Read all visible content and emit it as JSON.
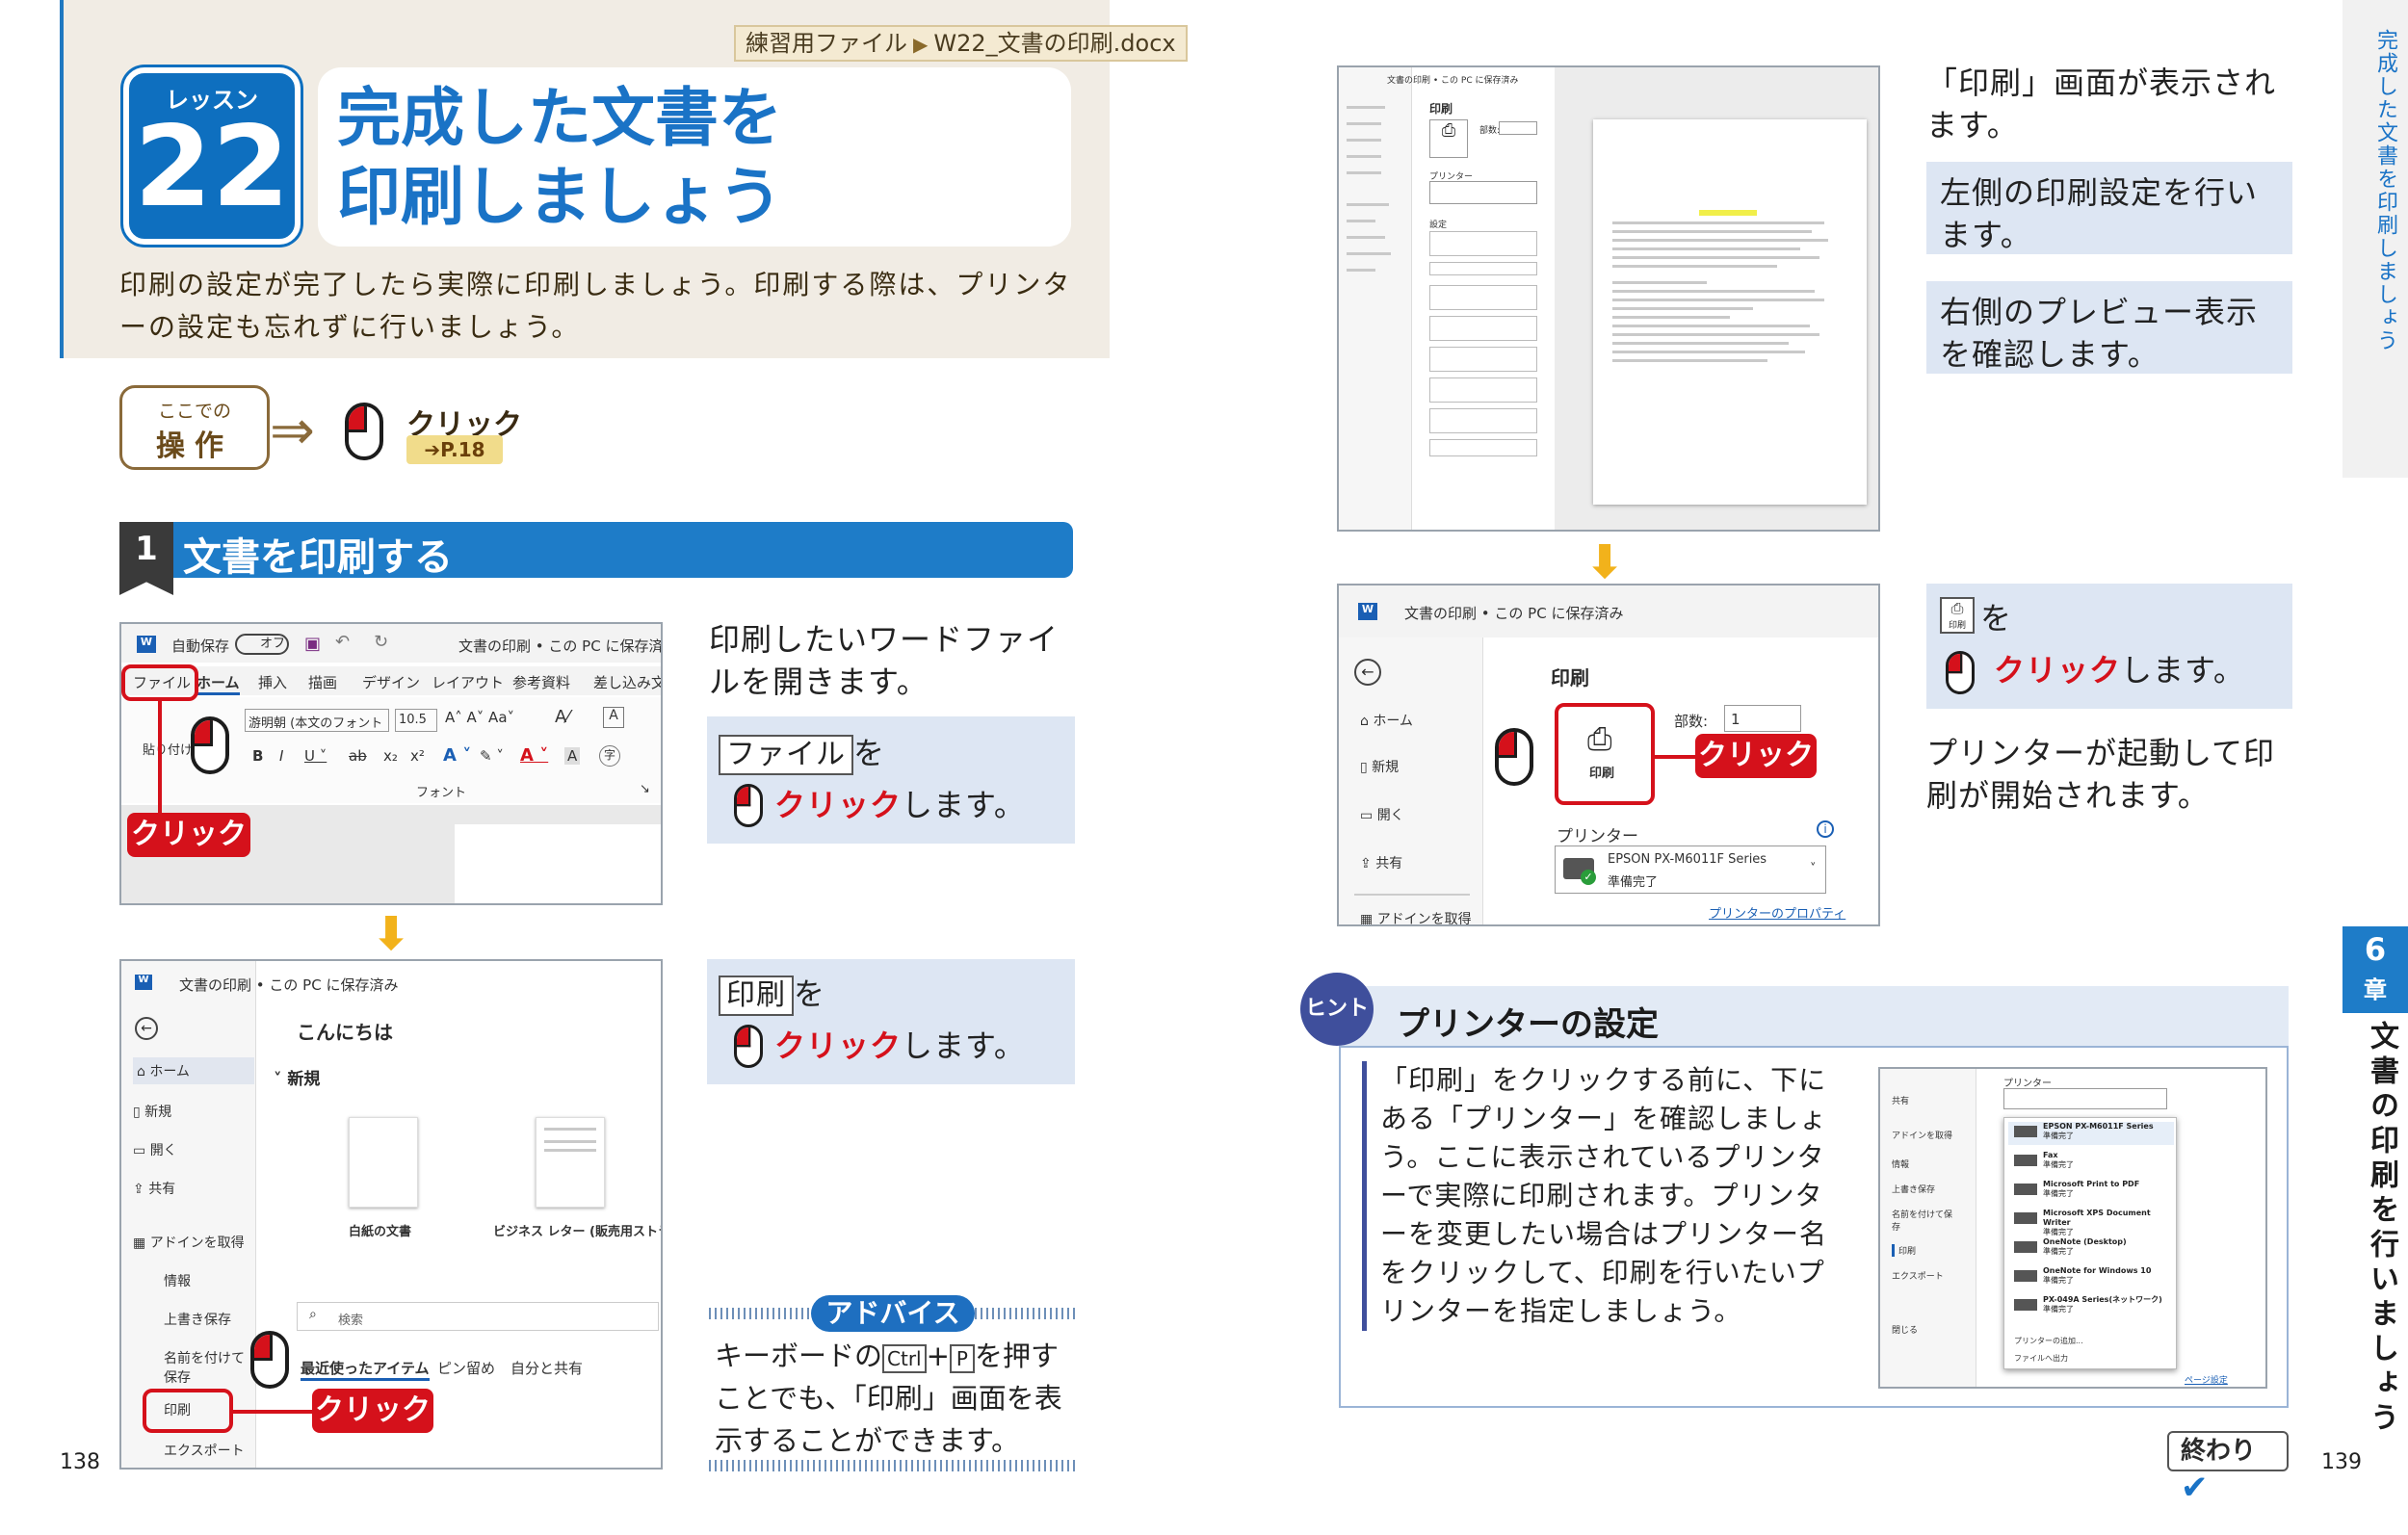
{
  "left_page": {
    "practice_file": {
      "label": "練習用ファイル",
      "file": "W22_文書の印刷.docx"
    },
    "lesson": {
      "label": "レッスン",
      "number": "22"
    },
    "title_line1": "完成した文書を",
    "title_line2": "印刷しましょう",
    "intro": "印刷の設定が完了したら実際に印刷しましょう。印刷する際は、プリンターの設定も忘れずに行いましょう。",
    "operation": {
      "small": "ここでの",
      "big": "操作",
      "action": "クリック",
      "ref": "P.18"
    },
    "section": {
      "number": "1",
      "title": "文書を印刷する"
    },
    "step1": {
      "text": "印刷したいワードファイルを開きます。",
      "key": "ファイル",
      "key_suffix": "を",
      "click": "クリック",
      "suffix": "します。"
    },
    "step2": {
      "key": "印刷",
      "key_suffix": "を",
      "click": "クリック",
      "suffix": "します。"
    },
    "advice": {
      "label": "アドバイス",
      "text_pre": "キーボードの",
      "ctrl": "Ctrl",
      "plus": "+",
      "p": "P",
      "text_post": "を押すことでも、「印刷」画面を表示することができます。"
    },
    "page_number": "138",
    "shot1": {
      "autosave": "自動保存",
      "toggle": "オフ",
      "doc_status": "文書の印刷 • この PC に保存済み",
      "tabs": [
        "ファイル",
        "ホーム",
        "挿入",
        "描画",
        "デザイン",
        "レイアウト",
        "参考資料",
        "差し込み文"
      ],
      "font_name": "游明朝 (本文のフォント",
      "font_size": "10.5",
      "group_font": "フォント",
      "paste": "貼り付け",
      "click": "クリック"
    },
    "shot2": {
      "doc_status": "文書の印刷 • この PC に保存済み",
      "greeting": "こんにちは",
      "new_label": "新規",
      "nav": [
        "ホーム",
        "新規",
        "開く",
        "共有",
        "アドインを取得",
        "情報",
        "上書き保存",
        "名前を付けて保存",
        "印刷",
        "エクスポート"
      ],
      "templates": [
        "白紙の文書",
        "ビジネス レター (販売用ストラ…"
      ],
      "search": "検索",
      "recent_tabs": [
        "最近使ったアイテム",
        "ピン留め",
        "自分と共有"
      ],
      "click": "クリック"
    }
  },
  "right_page": {
    "step3": {
      "line1": "「印刷」画面が表示されます。",
      "line2": "左側の印刷設定を行います。",
      "line3": "右側のプレビュー表示を確認します。"
    },
    "step4": {
      "icon_label": "印刷",
      "key_suffix": "を",
      "click": "クリック",
      "suffix": "します。",
      "after": "プリンターが起動して印刷が開始されます。"
    },
    "shot3": {
      "title": "印刷",
      "copies": "部数:",
      "printer": "プリンター",
      "settings": "設定",
      "doc_status": "文書の印刷 • この PC に保存済み"
    },
    "shot4": {
      "doc_status": "文書の印刷 • この PC に保存済み",
      "title": "印刷",
      "copies_label": "部数:",
      "copies_value": "1",
      "nav": [
        "ホーム",
        "新規",
        "開く",
        "共有",
        "アドインを取得"
      ],
      "print_btn": "印刷",
      "click": "クリック",
      "printer_label": "プリンター",
      "printer_name": "EPSON PX-M6011F Series",
      "printer_status": "準備完了",
      "printer_props": "プリンターのプロパティ"
    },
    "hint": {
      "badge": "ヒント",
      "title": "プリンターの設定",
      "text": "「印刷」をクリックする前に、下にある「プリンター」を確認しましょう。ここに表示されているプリンターで実際に印刷されます。プリンターを変更したい場合はプリンター名をクリックして、印刷を行いたいプリンターを指定しましょう。"
    },
    "hint_shot": {
      "printer_label": "プリンター",
      "nav": [
        "共有",
        "アドインを取得",
        "情報",
        "上書き保存",
        "名前を付けて保存",
        "印刷",
        "エクスポート",
        "閉じる"
      ],
      "printers": [
        {
          "name": "EPSON PX-M6011F Series",
          "status": "準備完了"
        },
        {
          "name": "Fax",
          "status": "準備完了"
        },
        {
          "name": "Microsoft Print to PDF",
          "status": "準備完了"
        },
        {
          "name": "Microsoft XPS Document Writer",
          "status": "準備完了"
        },
        {
          "name": "OneNote (Desktop)",
          "status": "準備完了"
        },
        {
          "name": "OneNote for Windows 10",
          "status": "準備完了"
        },
        {
          "name": "PX-049A Series(ネットワーク)",
          "status": "準備完了"
        }
      ],
      "add_printer": "プリンターの追加...",
      "file_output": "ファイルへ出力",
      "page_setup": "ページ設定"
    },
    "side_tab": "完成した文書を印刷しましょう",
    "chapter": {
      "number": "6",
      "label": "章",
      "title": "文書の印刷を行いましょう"
    },
    "end_label": "終わり",
    "page_number": "139"
  },
  "colors": {
    "accent": "#1e7cc8",
    "red": "#d5111b",
    "step_bg": "#dde6f3",
    "arrow": "#f2b21b"
  }
}
